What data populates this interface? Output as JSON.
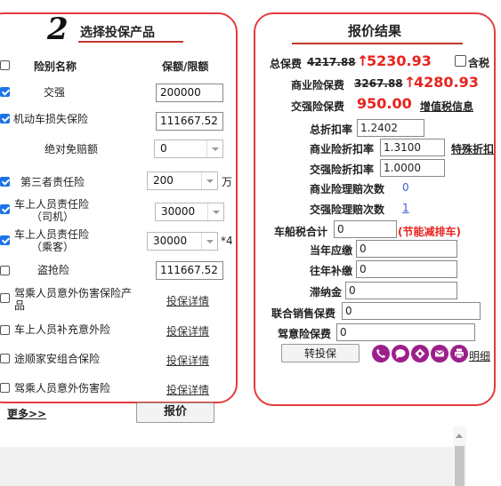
{
  "left": {
    "step_number": "2",
    "title": "选择投保产品",
    "header_name": "险别名称",
    "header_amount": "保额/限额",
    "rows": {
      "jq": {
        "label": "交强",
        "value": "200000"
      },
      "csx": {
        "label": "机动车损失保险",
        "value": "111667.52"
      },
      "mpe": {
        "label": "绝对免赔额",
        "value": "0"
      },
      "szx": {
        "label": "第三者责任险",
        "value": "200",
        "unit": "万"
      },
      "sj": {
        "label_line1": "车上人员责任险",
        "label_line2": "（司机）",
        "value": "30000"
      },
      "ck": {
        "label_line1": "车上人员责任险",
        "label_line2": "（乘客）",
        "value": "30000",
        "multiplier": "*4"
      },
      "dq": {
        "label": "盗抢险",
        "value": "111667.52"
      },
      "jcr": {
        "label_line1": "驾乘人员意外伤害保险产",
        "label_line2": "品",
        "link": "投保详情"
      },
      "cbc": {
        "label": "车上人员补充意外险",
        "link": "投保详情"
      },
      "tsj": {
        "label": "途顺家安组合保险",
        "link": "投保详情"
      },
      "jcy": {
        "label": "驾乘人员意外伤害险",
        "link": "投保详情"
      }
    },
    "more_link": "更多>>",
    "quote_button": "报价"
  },
  "right": {
    "title": "报价结果",
    "total_premium_label": "总保费",
    "total_old": "4217.88",
    "total_new": "5230.93",
    "tax_label": "含税",
    "commercial_label": "商业险保费",
    "commercial_old": "3267.88",
    "commercial_new": "4280.93",
    "compulsory_label": "交强险保费",
    "compulsory_value": "950.00",
    "vat_link": "增值税信息",
    "total_discount_label": "总折扣率",
    "total_discount": "1.2402",
    "commercial_discount_label": "商业险折扣率",
    "commercial_discount": "1.3100",
    "special_discount_link": "特殊折扣",
    "compulsory_discount_label": "交强险折扣率",
    "compulsory_discount": "1.0000",
    "commercial_claims_label": "商业险理赔次数",
    "commercial_claims": "0",
    "compulsory_claims_label": "交强险理赔次数",
    "compulsory_claims": "1",
    "vessel_tax_label": "车船税合计",
    "vessel_tax": "0",
    "vessel_tax_note": "(节能减排车)",
    "current_due_label": "当年应缴",
    "current_due": "0",
    "prev_supplement_label": "往年补缴",
    "prev_supplement": "0",
    "late_fee_label": "滞纳金",
    "late_fee": "0",
    "joint_sales_label": "联合销售保费",
    "joint_sales": "0",
    "driver_accident_label": "驾意险保费",
    "driver_accident": "0",
    "transfer_button": "转投保",
    "detail_link": "明细"
  },
  "icons": [
    "phone-icon",
    "chat-icon",
    "share-icon",
    "mail-icon",
    "printer-icon"
  ],
  "colors": {
    "accent_red": "#e8231f",
    "panel_border": "#e23b3b",
    "icon_purple": "#9c1f8a",
    "link_blue": "#3b5bd6"
  }
}
